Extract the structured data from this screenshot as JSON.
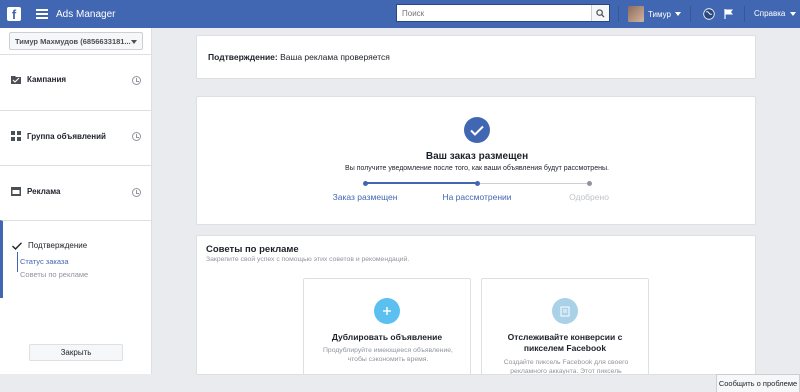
{
  "topbar": {
    "app_title": "Ads Manager",
    "search_placeholder": "Поиск",
    "user_name": "Тимур",
    "help_label": "Справка"
  },
  "sidebar": {
    "account_selector": "Тимур Махмудов (6856633181...",
    "items": [
      {
        "label": "Кампания",
        "icon": "folder-icon"
      },
      {
        "label": "Группа объявлений",
        "icon": "grid-icon"
      },
      {
        "label": "Реклама",
        "icon": "ad-icon"
      }
    ],
    "confirmation": {
      "label": "Подтверждение",
      "sub_items": [
        "Статус заказа",
        "Советы по рекламе"
      ]
    },
    "close_button": "Закрыть"
  },
  "main": {
    "confirmation_label": "Подтверждение:",
    "confirmation_status": "Ваша реклама проверяется",
    "order": {
      "title": "Ваш заказ размещен",
      "description": "Вы получите уведомление после того, как ваши объявления будут рассмотрены.",
      "steps": [
        "Заказ размещен",
        "На рассмотрении",
        "Одобрено"
      ],
      "progress_fraction": 0.5
    },
    "tips": {
      "title": "Советы по рекламе",
      "description": "Закрепите свой успех с помощью этих советов и рекомендаций.",
      "cards": [
        {
          "title": "Дублировать объявление",
          "description_lines": [
            "Продублируйте имеющееся объявление,",
            "чтобы сэкономить время."
          ]
        },
        {
          "title_lines": [
            "Отслеживайте конверсии с",
            "пикселем Facebook"
          ],
          "description_lines": [
            "Создайте пиксель Facebook для своего",
            "рекламного аккаунта. Этот пиксель"
          ]
        }
      ]
    }
  },
  "report_button": "Сообщить о проблеме",
  "colors": {
    "brand": "#4267b2",
    "muted": "#bec3c9",
    "pixel_icon": "#a9d1e8",
    "duplicate_icon": "#5bc0f0"
  }
}
